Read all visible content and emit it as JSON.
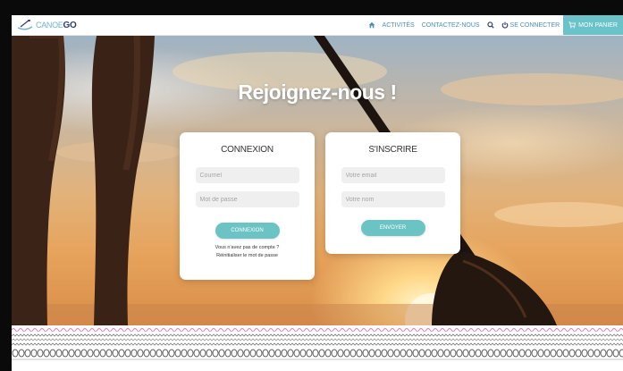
{
  "brand": {
    "name_prefix": "CANOE",
    "name_suffix": "GO"
  },
  "nav": {
    "activities": "Activités",
    "contact": "Contactez-nous",
    "login": "Se connecter",
    "cart": "Mon panier"
  },
  "hero": {
    "title": "Rejoignez-nous !"
  },
  "login_card": {
    "title": "Connexion",
    "email_placeholder": "Courriel",
    "password_placeholder": "Mot de passe",
    "submit_label": "Connexion",
    "no_account_text": "Vous n'avez pas de compte ?",
    "reset_password_text": "Réinitialiser le mot de passe"
  },
  "signup_card": {
    "title": "S'inscrire",
    "email_placeholder": "Votre email",
    "name_placeholder": "Votre nom",
    "submit_label": "Envoyer"
  },
  "colors": {
    "accent_teal": "#6cc3c4",
    "nav_link_blue": "#4b8fb5",
    "brand_navy": "#2e3e6e",
    "pattern_pink": "#e67bb2"
  }
}
